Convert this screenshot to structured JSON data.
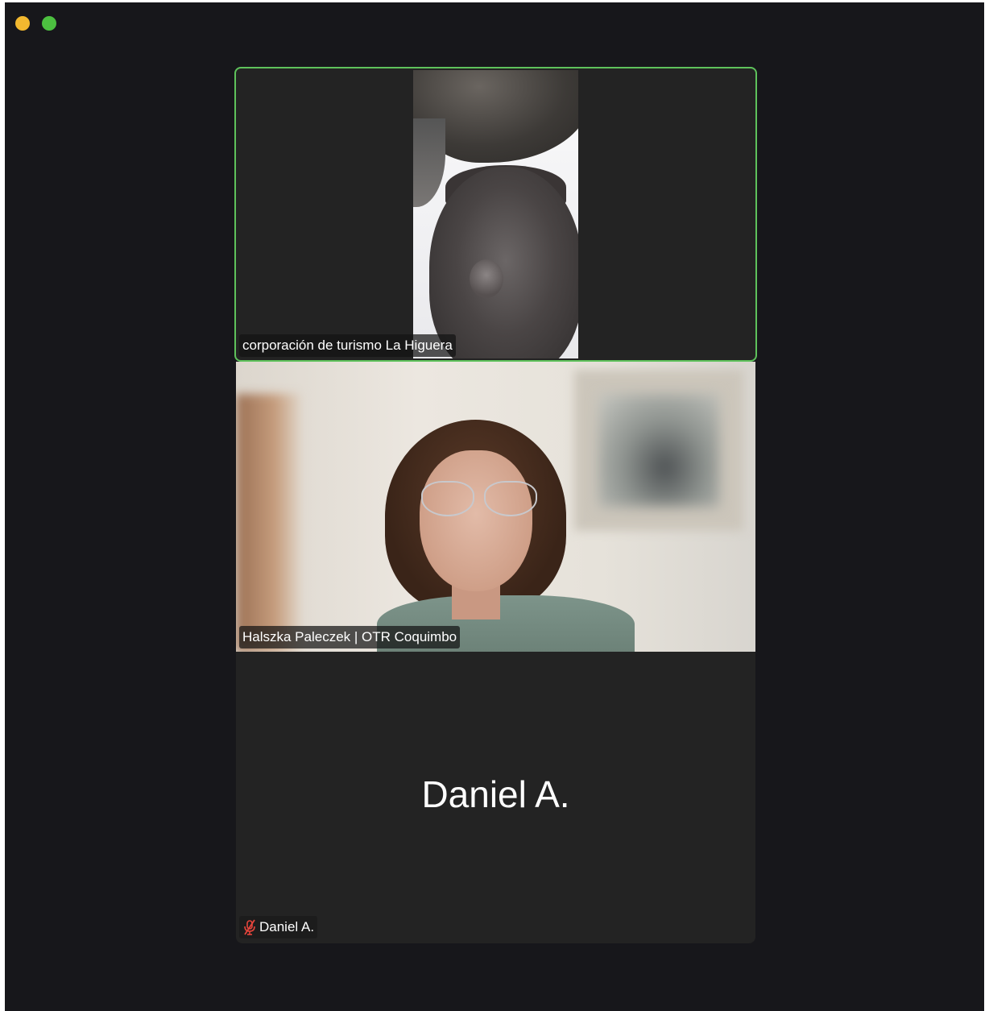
{
  "window": {
    "controls": [
      "minimize",
      "zoom"
    ]
  },
  "participants": [
    {
      "name": "corporación de turismo La Higuera",
      "speaking": true,
      "video": "on"
    },
    {
      "name": "Halszka Paleczek | OTR Coquimbo",
      "speaking": false,
      "video": "on"
    },
    {
      "name": "Daniel A.",
      "display_name": "Daniel A.",
      "speaking": false,
      "video": "off",
      "muted": true
    }
  ],
  "colors": {
    "background": "#17171b",
    "tile": "#232323",
    "active_speaker_border": "#5ec25b",
    "mute_icon": "#e5443b"
  }
}
